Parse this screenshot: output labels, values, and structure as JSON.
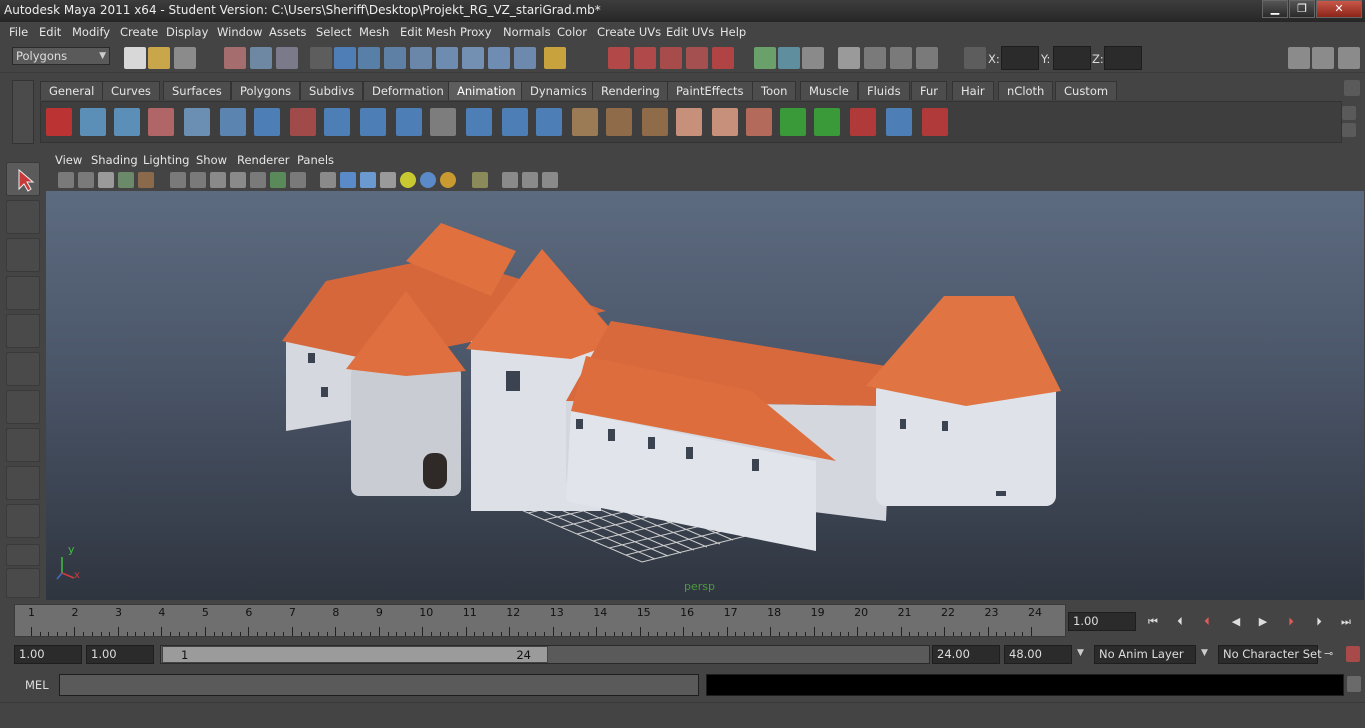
{
  "window": {
    "title": "Autodesk Maya 2011 x64 - Student Version: C:\\Users\\Sheriff\\Desktop\\Projekt_RG_VZ_stariGrad.mb*",
    "minimize": "▁",
    "restore": "❐",
    "close": "✕"
  },
  "menubar": [
    "File",
    "Edit",
    "Modify",
    "Create",
    "Display",
    "Window",
    "Assets",
    "Select",
    "Mesh",
    "Edit Mesh",
    "Proxy",
    "Normals",
    "Color",
    "Create UVs",
    "Edit UVs",
    "Help"
  ],
  "status_line": {
    "mode": "Polygons",
    "x_label": "X:",
    "y_label": "Y:",
    "z_label": "Z:",
    "x_value": "",
    "y_value": "",
    "z_value": ""
  },
  "shelf": {
    "tabs": [
      "General",
      "Curves",
      "Surfaces",
      "Polygons",
      "Subdivs",
      "Deformation",
      "Animation",
      "Dynamics",
      "Rendering",
      "PaintEffects",
      "Toon",
      "Muscle",
      "Fluids",
      "Fur",
      "Hair",
      "nCloth",
      "Custom"
    ],
    "active_tab": "Animation"
  },
  "panel": {
    "menus": [
      "View",
      "Shading",
      "Lighting",
      "Show",
      "Renderer",
      "Panels"
    ],
    "camera": "persp",
    "axis_y": "y",
    "axis_x": "x"
  },
  "time_slider": {
    "ticks": [
      "1",
      "2",
      "3",
      "4",
      "5",
      "6",
      "7",
      "8",
      "9",
      "10",
      "11",
      "12",
      "13",
      "14",
      "15",
      "16",
      "17",
      "18",
      "19",
      "20",
      "21",
      "22",
      "23",
      "24"
    ],
    "current_time": "1.00"
  },
  "range_slider": {
    "start": "1.00",
    "playback_start": "1.00",
    "slider_min": "1",
    "slider_max": "24",
    "playback_end": "24.00",
    "end": "48.00",
    "anim_layer": "No Anim Layer",
    "character_set": "No Character Set"
  },
  "command_line": {
    "label": "MEL",
    "input": "",
    "result": ""
  },
  "help_line": {
    "text": ""
  },
  "colors": {
    "ui_bg": "#444444",
    "roof": "#d9683a",
    "wall": "#d9dde3",
    "grid": "#cfcfcf",
    "camera_label": "#4a9a3e"
  }
}
